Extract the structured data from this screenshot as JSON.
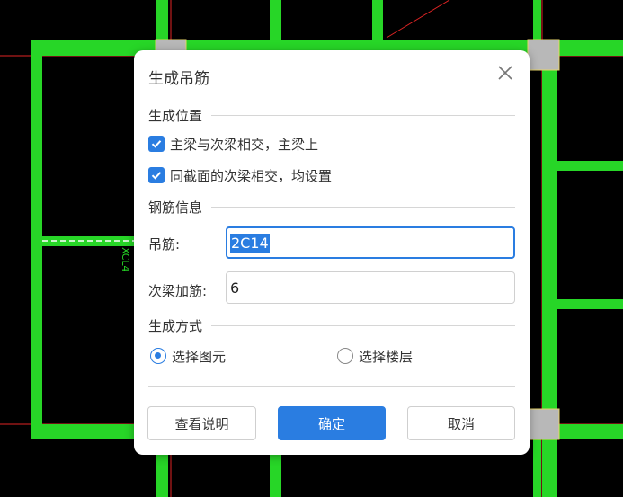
{
  "canvas": {
    "beam_color": "#27d627",
    "axis_color": "#e02424",
    "node_color": "#b8b8b8",
    "label_text": "XCL4"
  },
  "dialog": {
    "title": "生成吊筋",
    "close_icon": "close-icon"
  },
  "position_section": {
    "heading": "生成位置",
    "options": [
      {
        "label": "主梁与次梁相交，主梁上",
        "checked": true
      },
      {
        "label": "同截面的次梁相交，均设置",
        "checked": true
      }
    ]
  },
  "rebar_section": {
    "heading": "钢筋信息",
    "hanger_label": "吊筋:",
    "hanger_value": "2C14",
    "extra_label": "次梁加筋:",
    "extra_value": "6"
  },
  "method_section": {
    "heading": "生成方式",
    "options": [
      {
        "label": "选择图元",
        "selected": true
      },
      {
        "label": "选择楼层",
        "selected": false
      }
    ]
  },
  "buttons": {
    "help": "查看说明",
    "ok": "确定",
    "cancel": "取消"
  },
  "colors": {
    "accent": "#2a7de1"
  }
}
